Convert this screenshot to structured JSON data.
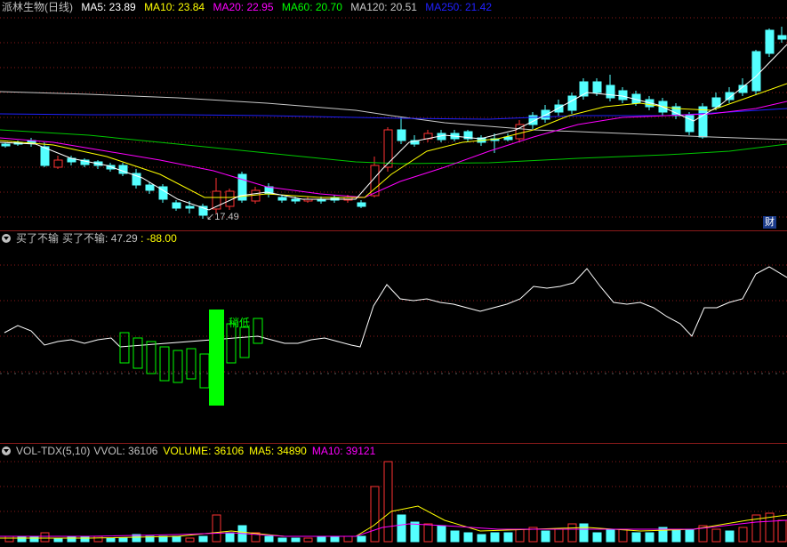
{
  "main": {
    "stock_name": "派林生物(日线)",
    "ma": [
      {
        "label": "MA5: 23.89",
        "color": "#ffffff"
      },
      {
        "label": "MA10: 23.84",
        "color": "#ffff00"
      },
      {
        "label": "MA20: 22.95",
        "color": "#ff00ff"
      },
      {
        "label": "MA60: 20.70",
        "color": "#00ff00"
      },
      {
        "label": "MA120: 20.51",
        "color": "#c8c8c8"
      },
      {
        "label": "MA250: 21.42",
        "color": "#0000ff"
      }
    ],
    "low_marker": "17.49",
    "fin_badge": "财"
  },
  "indicator": {
    "title": "买了不输",
    "name": "买了不输",
    "value": "47.29",
    "value2": ": -88.00",
    "signal_text": "稍低"
  },
  "volume": {
    "title": "VOL-TDX(5,10)",
    "vvol": "VVOL: 36106",
    "volume": "VOLUME: 36106",
    "ma5": "MA5: 34890",
    "ma10": "MA10: 39121"
  },
  "colors": {
    "up": "#ff3232",
    "down": "#54ffff",
    "grid": "#8b1a1a",
    "green_signal": "#00ff00",
    "white_line": "#ffffff"
  }
}
